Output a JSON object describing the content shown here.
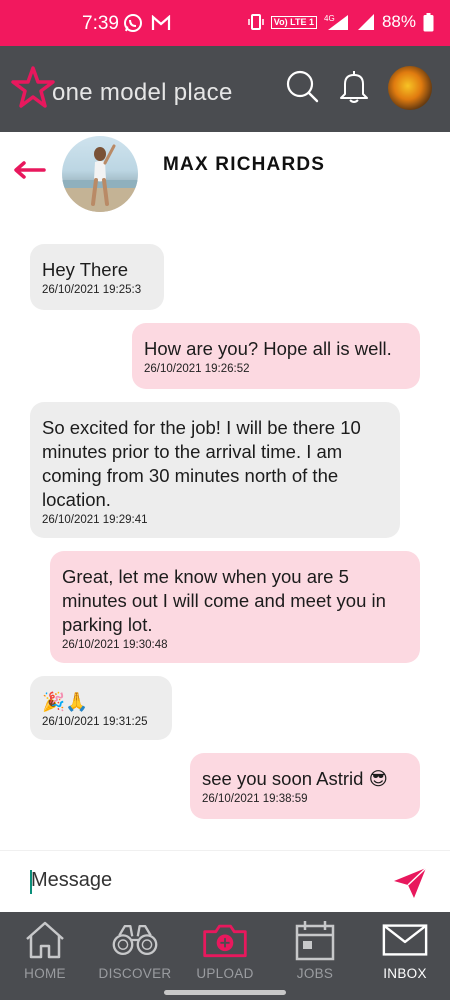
{
  "status_bar": {
    "time": "7:39",
    "battery": "88%",
    "network": "4G",
    "lte_label": "Vo) LTE 1",
    "background": "#f2185e"
  },
  "header": {
    "logo_text": "one model place",
    "icons": [
      "star-logo-icon",
      "search-icon",
      "bell-icon",
      "avatar"
    ],
    "background": "#4a4c50"
  },
  "chat": {
    "contact_name": "MAX RICHARDS",
    "back_icon": "arrow-left-icon",
    "accent": "#e8185d"
  },
  "messages": [
    {
      "direction": "in",
      "text": "Hey There",
      "time": "26/10/2021 19:25:3"
    },
    {
      "direction": "out",
      "text": "How are you? Hope all is well.",
      "time": "26/10/2021 19:26:52"
    },
    {
      "direction": "in",
      "text": "So excited for the job! I will be there 10 minutes prior to the arrival time. I am coming from 30 minutes north of the location.",
      "time": "26/10/2021 19:29:41"
    },
    {
      "direction": "out",
      "text": "Great, let me know when you are 5 minutes out I will come and meet you in parking lot.",
      "time": "26/10/2021 19:30:48"
    },
    {
      "direction": "in",
      "text": "🎉🙏",
      "time": "26/10/2021 19:31:25"
    },
    {
      "direction": "out",
      "text": "see you soon Astrid 😎",
      "time": "26/10/2021 19:38:59"
    }
  ],
  "composer": {
    "placeholder": "Message",
    "send_icon": "send-icon"
  },
  "bottom_nav": [
    {
      "label": "HOME",
      "icon": "home-icon",
      "active": false
    },
    {
      "label": "DISCOVER",
      "icon": "binoculars-icon",
      "active": false
    },
    {
      "label": "UPLOAD",
      "icon": "camera-icon",
      "active": false
    },
    {
      "label": "JOBS",
      "icon": "calendar-icon",
      "active": false
    },
    {
      "label": "INBOX",
      "icon": "envelope-icon",
      "active": true
    }
  ]
}
